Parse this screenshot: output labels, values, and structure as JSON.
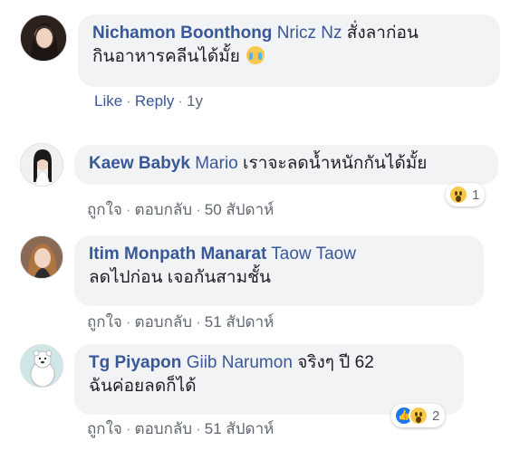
{
  "comments": [
    {
      "author": "Nichamon Boonthong",
      "mention": "Nricz Nz",
      "line1": "สั่งลาก่อน",
      "line2": "กินอาหารคลีนได้มั้ย",
      "emoji": "crying-face",
      "like": "Like",
      "reply": "Reply",
      "time": "1y"
    },
    {
      "author": "Kaew Babyk",
      "mention": "Mario",
      "line1": "เราจะลดน้ำหนักกันได้มั้ย",
      "like": "ถูกใจ",
      "reply": "ตอบกลับ",
      "time": "50 สัปดาห์",
      "reactions": [
        "wow"
      ],
      "reaction_count": "1"
    },
    {
      "author": "Itim Monpath Manarat",
      "mention": "Taow Taow",
      "line2": "ลดไปก่อน เจอกันสามชั้น",
      "like": "ถูกใจ",
      "reply": "ตอบกลับ",
      "time": "51 สัปดาห์"
    },
    {
      "author": "Tg Piyapon",
      "mention": "Giib Narumon",
      "line1": "จริงๆ ปี 62",
      "line2": "ฉันค่อยลดก็ได้",
      "like": "ถูกใจ",
      "reply": "ตอบกลับ",
      "time": "51 สัปดาห์",
      "reactions": [
        "like",
        "wow"
      ],
      "reaction_count": "2"
    }
  ],
  "separator": "·",
  "colors": {
    "link": "#385898",
    "bubble": "#f2f3f5",
    "meta": "#606770"
  }
}
